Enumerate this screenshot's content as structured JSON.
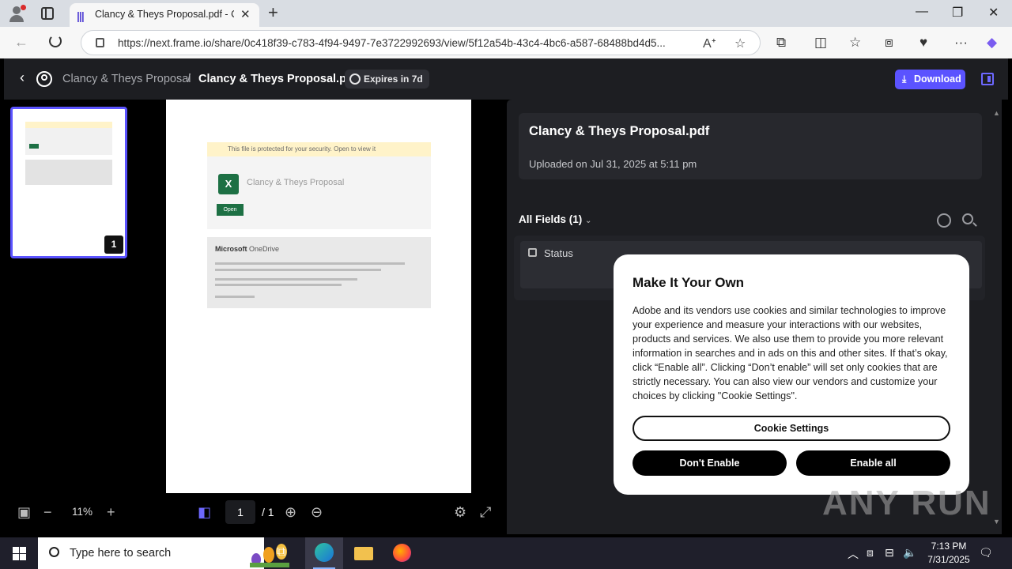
{
  "browser": {
    "tab_title": "Clancy & Theys Proposal.pdf - Cla",
    "url": "https://next.frame.io/share/0c418f39-c783-4f94-9497-7e3722992693/view/5f12a54b-43c4-4bc6-a587-68488bd4d5...",
    "icons": [
      "profile-icon",
      "tab-actions-icon",
      "close-icon",
      "plus-icon",
      "back-icon",
      "reload-icon",
      "lock-icon",
      "read-aloud-icon",
      "star-icon",
      "extensions-icon",
      "split-icon",
      "favorites-icon",
      "collections-icon",
      "performance-icon",
      "more-icon",
      "copilot-icon"
    ]
  },
  "header": {
    "breadcrumb_parent": "Clancy & Theys Proposal",
    "breadcrumb_sep": "/",
    "file_name": "Clancy & Theys Proposal.pdf",
    "expires": "Expires in 7d",
    "download": "Download"
  },
  "thumbnail": {
    "page_badge": "1"
  },
  "document": {
    "banner_text": "This file is protected for your security. Open to view it",
    "card_title": "Clancy & Theys Proposal",
    "open_label": "Open",
    "onedrive_brand": "Microsoft",
    "onedrive_name": "OneDrive"
  },
  "controls": {
    "zoom": "11%",
    "page_current": "1",
    "page_total": "/ 1"
  },
  "panel": {
    "file_name": "Clancy & Theys Proposal.pdf",
    "uploaded": "Uploaded on Jul 31, 2025 at 5:11 pm",
    "fields_label": "All Fields (1)",
    "status_label": "Status"
  },
  "cookie_modal": {
    "title": "Make It Your Own",
    "body": "Adobe and its vendors use cookies and similar technologies to improve your experience and measure your interactions with our websites, products and services. We also use them to provide you more relevant information in searches and in ads on this and other sites. If that’s okay, click “Enable all”. Clicking “Don’t enable” will set only cookies that are strictly necessary. You can also view our vendors and customize your choices by clicking \"Cookie Settings\".",
    "settings_label": "Cookie Settings",
    "dont_label": "Don't Enable",
    "enable_label": "Enable all"
  },
  "watermark": "ANY RUN",
  "taskbar": {
    "search_placeholder": "Type here to search",
    "time": "7:13 PM",
    "date": "7/31/2025"
  },
  "colors": {
    "accent": "#5b53ff",
    "panel_bg": "#1d1e22",
    "taskbar_bg": "#1f1f2b"
  }
}
